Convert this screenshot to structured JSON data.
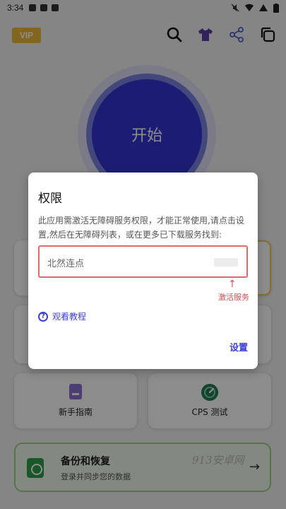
{
  "status_bar": {
    "time": "3:34"
  },
  "header": {
    "vip_label": "VIP"
  },
  "start_button": {
    "label": "开始"
  },
  "cards": {
    "guide": {
      "label": "新手指南"
    },
    "cps": {
      "label": "CPS 测试"
    }
  },
  "backup": {
    "title": "备份和恢复",
    "subtitle": "登录并同步您的数据"
  },
  "watermark": "913安卓网",
  "dialog": {
    "title": "权限",
    "message": "此应用需激活无障碍服务权限，才能正常使用,请点击设置,然后在无障碍列表，或在更多已下载服务找到:",
    "service_name": "北然连点",
    "arrow": "↑",
    "activate_hint": "激活服务",
    "tutorial_link": "观看教程",
    "settings_button": "设置"
  },
  "colors": {
    "accent": "#3434d6",
    "vip": "#f0b838",
    "warning": "#d05050",
    "link": "#3b3fd8",
    "backup_border": "#9fd28a"
  }
}
